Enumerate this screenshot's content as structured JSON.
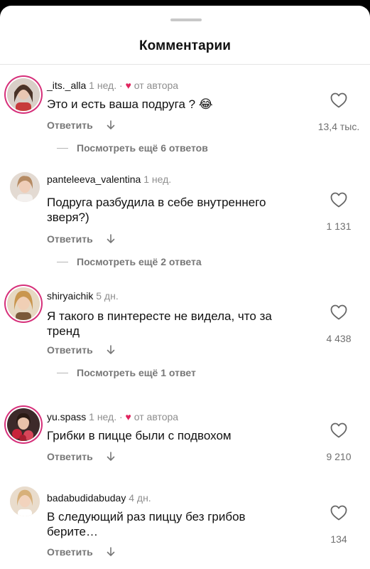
{
  "header": {
    "title": "Комментарии"
  },
  "reply_label": "Ответить",
  "comments": [
    {
      "username": "_its._alla",
      "time": "1 нед.",
      "separator": "·",
      "author_like": "от автора",
      "text": "Это и есть ваша подруга ? 😂",
      "likes": "13,4 тыс.",
      "more_replies": "Посмотреть ещё 6 ответов"
    },
    {
      "username": "panteleeva_valentina",
      "time": "1 нед.",
      "text": "Подруга разбудила в себе внутреннего зверя?)",
      "likes": "1 131",
      "more_replies": "Посмотреть ещё 2 ответа"
    },
    {
      "username": "shiryaichik",
      "time": "5 дн.",
      "text": "Я такого в пинтересте не видела, что за тренд",
      "likes": "4 438",
      "more_replies": "Посмотреть ещё 1 ответ"
    },
    {
      "username": "yu.spass",
      "time": "1 нед.",
      "separator": "·",
      "author_like": "от автора",
      "text": "Грибки в пицце были с подвохом",
      "likes": "9 210"
    },
    {
      "username": "badabudidabuday",
      "time": "4 дн.",
      "text": "В следующий раз пиццу без грибов берите…",
      "likes": "134"
    }
  ],
  "icons": {
    "like": "heart-outline-icon",
    "author_heart": "heart-filled-icon",
    "reply_arrow": "arrow-down-icon"
  },
  "colors": {
    "author_heart": "#e0245e",
    "story_ring": "#d6307a"
  }
}
